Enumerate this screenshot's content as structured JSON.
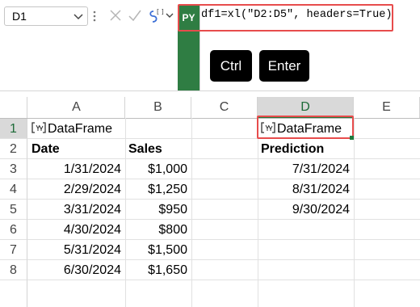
{
  "name_box": {
    "value": "D1"
  },
  "formula_bar": {
    "language_badge": "PY",
    "formula": "df1=xl(\"D2:D5\", headers=True)",
    "brand_color": "#2f7d43",
    "highlight_color": "#e74c4c"
  },
  "keys": {
    "ctrl": "Ctrl",
    "enter": "Enter"
  },
  "grid": {
    "columns": [
      "A",
      "B",
      "C",
      "D",
      "E"
    ],
    "active_column": "D",
    "active_row": "1",
    "rows": [
      "1",
      "2",
      "3",
      "4",
      "5",
      "6",
      "7",
      "8"
    ],
    "A1": "DataFrame",
    "D1": "DataFrame",
    "headers": {
      "date": "Date",
      "sales": "Sales",
      "prediction": "Prediction"
    },
    "dates": [
      "1/31/2024",
      "2/29/2024",
      "3/31/2024",
      "4/30/2024",
      "5/31/2024",
      "6/30/2024"
    ],
    "sales": [
      "$1,000",
      "$1,250",
      "$950",
      "$800",
      "$1,500",
      "$1,650"
    ],
    "predictions": [
      "7/31/2024",
      "8/31/2024",
      "9/30/2024"
    ]
  }
}
